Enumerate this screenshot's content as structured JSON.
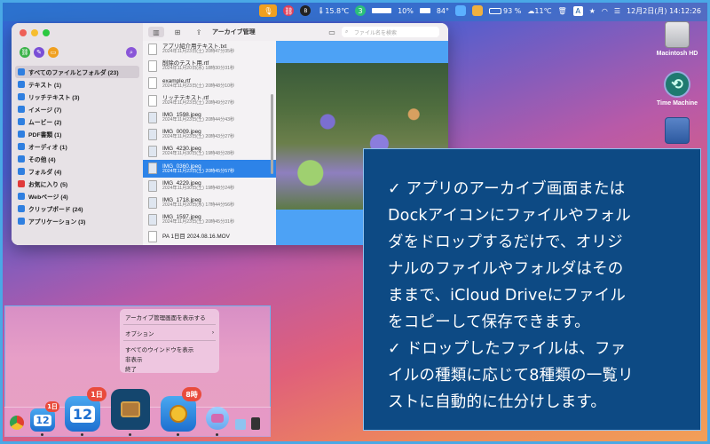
{
  "menubar": {
    "temp1": "15.8℃",
    "badge": "3",
    "pct": "10%",
    "deg": "84°",
    "battery": "93 %",
    "temp2": "11℃",
    "letter": "A",
    "date": "12月2日(月) 14:12:26"
  },
  "desktop": {
    "hd_label": "Macintosh HD",
    "tm_label": "Time Machine"
  },
  "window": {
    "title": "アーカイブ管理",
    "search_placeholder": "ファイル名を検索",
    "sidebar": [
      {
        "label": "すべてのファイルとフォルダ (23)",
        "color": "#2f7fe0"
      },
      {
        "label": "テキスト (1)",
        "color": "#2f7fe0"
      },
      {
        "label": "リッチテキスト (3)",
        "color": "#2f7fe0"
      },
      {
        "label": "イメージ (7)",
        "color": "#2f7fe0"
      },
      {
        "label": "ムービー (2)",
        "color": "#2f7fe0"
      },
      {
        "label": "PDF書類 (1)",
        "color": "#2f7fe0"
      },
      {
        "label": "オーディオ (1)",
        "color": "#2f7fe0"
      },
      {
        "label": "その他 (4)",
        "color": "#2f7fe0"
      },
      {
        "label": "フォルダ (4)",
        "color": "#2f7fe0"
      },
      {
        "label": "お気に入り (5)",
        "color": "#e03a3a"
      },
      {
        "label": "Webページ (4)",
        "color": "#2f7fe0"
      },
      {
        "label": "クリップボード (24)",
        "color": "#2f7fe0"
      },
      {
        "label": "アプリケーション (3)",
        "color": "#2f7fe0"
      }
    ],
    "files": [
      {
        "name": "アプリ紹介用テキスト.txt",
        "date": "2024年11月23日(土) 20時47分35秒",
        "type": "txt"
      },
      {
        "name": "削除のテスト用.rtf",
        "date": "2024年11月20日(水) 18時30分31秒",
        "type": "rtf"
      },
      {
        "name": "example.rtf",
        "date": "2024年11月23日(土) 20時48分10秒",
        "type": "rtf"
      },
      {
        "name": "リッチテキスト.rtf",
        "date": "2024年11月23日(土) 20時49分27秒",
        "type": "rtf"
      },
      {
        "name": "IMG_1598.jpeg",
        "date": "2024年11月23日(土) 20時44分43秒",
        "type": "img"
      },
      {
        "name": "IMG_0009.jpeg",
        "date": "2024年11月23日(土) 20時43分27秒",
        "type": "img"
      },
      {
        "name": "IMG_4230.jpeg",
        "date": "2024年11月30日(土) 19時48分28秒",
        "type": "img"
      },
      {
        "name": "IMG_0360.jpeg",
        "date": "2024年11月23日(土) 20時45分57秒",
        "type": "img",
        "selected": true
      },
      {
        "name": "IMG_4229.jpeg",
        "date": "2024年11月30日(土) 19時48分24秒",
        "type": "img"
      },
      {
        "name": "IMG_1718.jpeg",
        "date": "2024年11月20日(水) 17時44分56秒",
        "type": "img"
      },
      {
        "name": "IMG_1597.jpeg",
        "date": "2024年11月23日(土) 20時45分31秒",
        "type": "img"
      },
      {
        "name": "PA 1日目 2024.08.16.MOV",
        "date": "",
        "type": "mov"
      }
    ]
  },
  "textbox": {
    "lines": [
      "✓ アプリのアーカイブ画面または",
      "Dockアイコンにファイルやフォル",
      "ダをドロップするだけで、オリジ",
      "ナルのファイルやフォルダはその",
      "ままで、iCloud Driveにファイル",
      "をコピーして保存できます。",
      "✓ ドロップしたファイルは、ファ",
      "イルの種類に応じて8種類の一覧リ",
      "ストに自動的に仕分けします。"
    ]
  },
  "context_menu": {
    "items": [
      "アーカイブ管理画面を表示する",
      "オプション",
      "すべてのウインドウを表示",
      "非表示",
      "終了"
    ],
    "submenu_arrow": "›"
  },
  "dock": {
    "cal1_day": "12",
    "badge1": "1日",
    "cal2_day": "12",
    "badge2": "1日",
    "badge3": "8時"
  }
}
